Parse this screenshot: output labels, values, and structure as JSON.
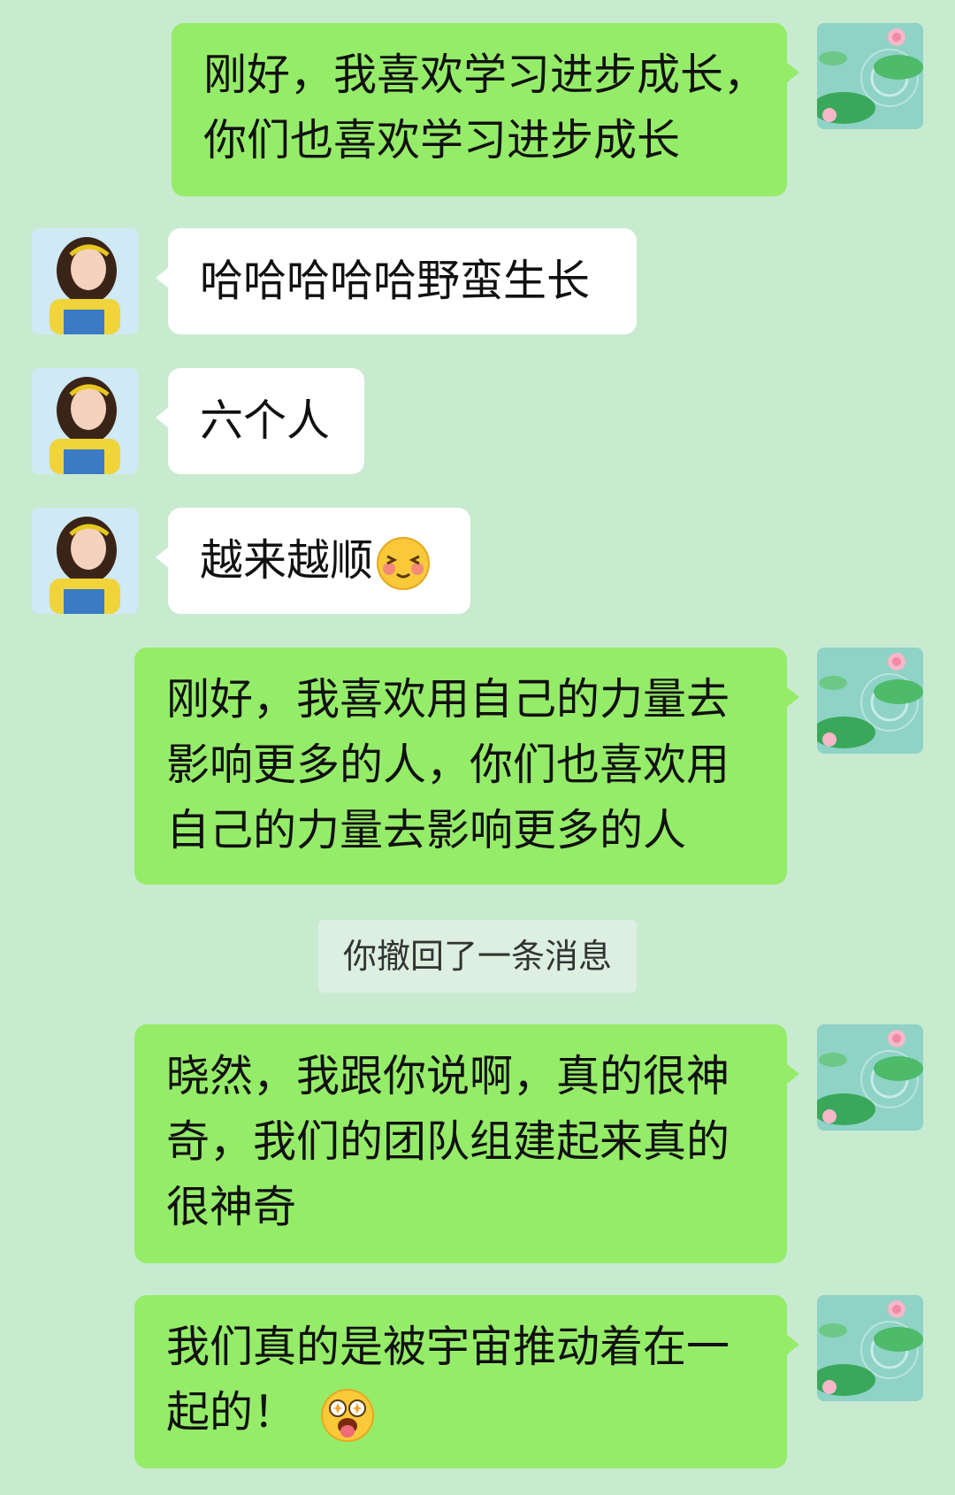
{
  "chat": {
    "messages": [
      {
        "sender": "self",
        "lines": [
          "刚好，我喜欢学习进步成长，",
          "你们也喜欢学习进步成长"
        ]
      },
      {
        "sender": "other",
        "lines": [
          "哈哈哈哈哈野蛮生长"
        ]
      },
      {
        "sender": "other",
        "lines": [
          "六个人"
        ]
      },
      {
        "sender": "other",
        "lines": [
          "越来越顺"
        ],
        "emoji": "shy-face-emoji"
      },
      {
        "sender": "self",
        "lines": [
          "刚好，我喜欢用自己的力量去",
          "影响更多的人，你们也喜欢用",
          "自己的力量去影响更多的人"
        ]
      },
      {
        "sender": "self",
        "lines": [
          "晓然，我跟你说啊，真的很神",
          "奇，我们的团队组建起来真的",
          "很神奇"
        ]
      },
      {
        "sender": "self",
        "lines": [
          "我们真的是被宇宙推动着在一",
          "起的！"
        ],
        "emoji": "starry-eyed-tongue-emoji"
      }
    ],
    "system_note": "你撤回了一条消息"
  },
  "colors": {
    "background": "#c8ebd0",
    "self_bubble": "#95ec69",
    "other_bubble": "#ffffff",
    "system_note_bg": "#dcefe0"
  }
}
